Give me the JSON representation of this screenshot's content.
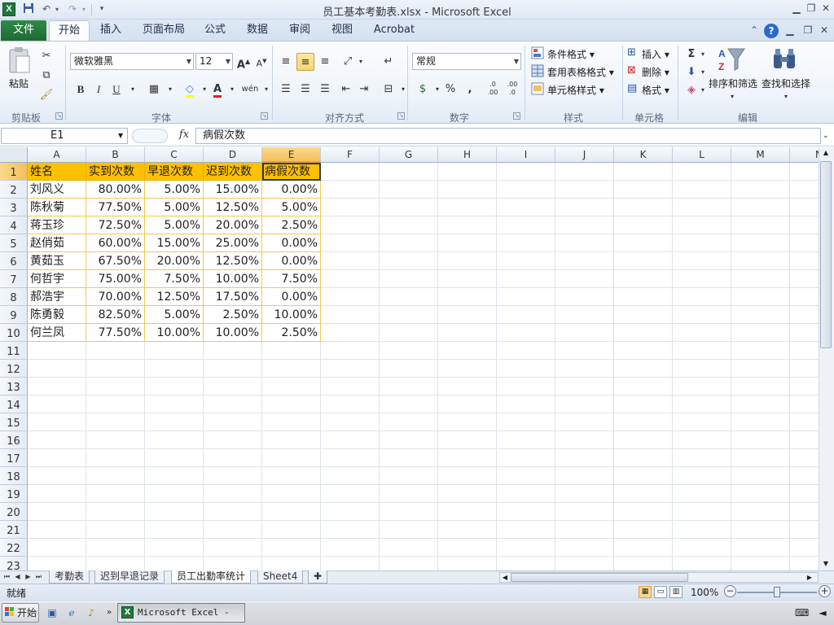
{
  "window": {
    "title": "员工基本考勤表.xlsx - Microsoft Excel",
    "app_logo": "X"
  },
  "ribbon": {
    "file_tab": "文件",
    "tabs": [
      "开始",
      "插入",
      "页面布局",
      "公式",
      "数据",
      "审阅",
      "视图",
      "Acrobat"
    ],
    "active_tab": "开始",
    "clipboard": {
      "paste": "粘贴",
      "group": "剪贴板"
    },
    "font": {
      "name": "微软雅黑",
      "size": "12",
      "group": "字体",
      "bold": "B",
      "italic": "I",
      "underline": "U",
      "grow": "A",
      "shrink": "A",
      "font_color": "A",
      "phonetic": "wén"
    },
    "alignment": {
      "group": "对齐方式"
    },
    "number": {
      "format": "常规",
      "group": "数字",
      "percent": "%",
      "comma": ",",
      "inc_dec": ".0 .00",
      "dec_dec": ".00 .0"
    },
    "styles": {
      "conditional": "条件格式",
      "table": "套用表格格式",
      "cell_styles": "单元格样式",
      "group": "样式"
    },
    "cells": {
      "insert": "插入",
      "delete": "删除",
      "format": "格式",
      "group": "单元格"
    },
    "editing": {
      "sum": "Σ",
      "sort_filter": "排序和筛选",
      "find_select": "查找和选择",
      "group": "编辑"
    }
  },
  "formula_bar": {
    "name_box": "E1",
    "fx": "fx",
    "content": "病假次数"
  },
  "sheet": {
    "columns": [
      "A",
      "B",
      "C",
      "D",
      "E",
      "F",
      "G",
      "H",
      "I",
      "J",
      "K",
      "L",
      "M",
      "N"
    ],
    "row_numbers": [
      "1",
      "2",
      "3",
      "4",
      "5",
      "6",
      "7",
      "8",
      "9",
      "10",
      "11",
      "12",
      "13",
      "14",
      "15",
      "16",
      "17",
      "18",
      "19",
      "20",
      "21",
      "22",
      "23"
    ],
    "header_row": [
      "姓名",
      "实到次数",
      "早退次数",
      "迟到次数",
      "病假次数"
    ],
    "rows": [
      [
        "刘风义",
        "80.00%",
        "5.00%",
        "15.00%",
        "0.00%"
      ],
      [
        "陈秋菊",
        "77.50%",
        "5.00%",
        "12.50%",
        "5.00%"
      ],
      [
        "蒋玉珍",
        "72.50%",
        "5.00%",
        "20.00%",
        "2.50%"
      ],
      [
        "赵俏茹",
        "60.00%",
        "15.00%",
        "25.00%",
        "0.00%"
      ],
      [
        "黄茹玉",
        "67.50%",
        "20.00%",
        "12.50%",
        "0.00%"
      ],
      [
        "何哲宇",
        "75.00%",
        "7.50%",
        "10.00%",
        "7.50%"
      ],
      [
        "郝浩宇",
        "70.00%",
        "12.50%",
        "17.50%",
        "0.00%"
      ],
      [
        "陈勇毅",
        "82.50%",
        "5.00%",
        "2.50%",
        "10.00%"
      ],
      [
        "何兰凤",
        "77.50%",
        "10.00%",
        "10.00%",
        "2.50%"
      ]
    ],
    "header_fill": "#ffc000",
    "border_color": "#f2c94c"
  },
  "sheet_tabs": [
    "考勤表",
    "迟到早退记录",
    "员工出勤率统计",
    "Sheet4"
  ],
  "active_sheet": "员工出勤率统计",
  "status": {
    "ready": "就绪",
    "zoom": "100%"
  },
  "taskbar": {
    "start": "开始",
    "task": "Microsoft Excel - ..."
  }
}
